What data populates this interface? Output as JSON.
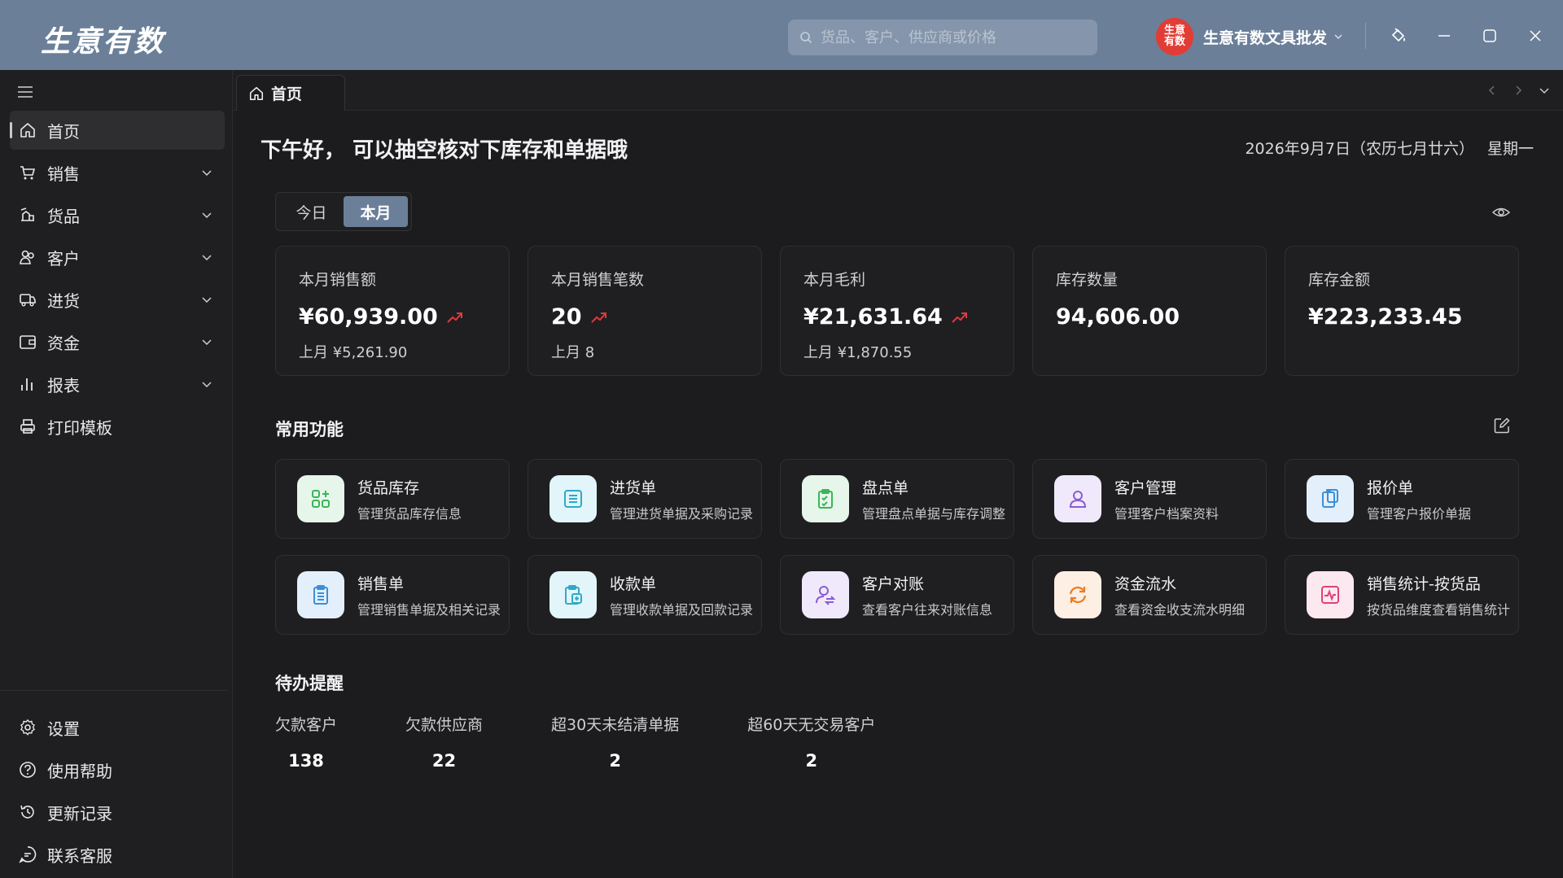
{
  "app": {
    "brand": "生意有数",
    "search_placeholder": "货品、客户、供应商或价格",
    "account_badge": "生意有数",
    "account_name": "生意有数文具批发"
  },
  "sidebar": {
    "items": [
      {
        "label": "首页",
        "icon": "home-icon",
        "active": true
      },
      {
        "label": "销售",
        "icon": "cart-icon"
      },
      {
        "label": "货品",
        "icon": "goods-icon"
      },
      {
        "label": "客户",
        "icon": "customer-icon"
      },
      {
        "label": "进货",
        "icon": "truck-icon"
      },
      {
        "label": "资金",
        "icon": "wallet-icon"
      },
      {
        "label": "报表",
        "icon": "chart-icon"
      },
      {
        "label": "打印模板",
        "icon": "printer-icon"
      }
    ],
    "bottom": [
      {
        "label": "设置",
        "icon": "gear-icon"
      },
      {
        "label": "使用帮助",
        "icon": "help-icon"
      },
      {
        "label": "更新记录",
        "icon": "history-icon"
      },
      {
        "label": "联系客服",
        "icon": "chat-icon"
      }
    ]
  },
  "tabs": [
    {
      "label": "首页"
    }
  ],
  "main": {
    "greeting": "下午好，  可以抽空核对下库存和单据哦",
    "date": "2026年9月7日（农历七月廿六）",
    "weekday": "星期一",
    "segments": [
      "今日",
      "本月"
    ],
    "stats": [
      {
        "label": "本月销售额",
        "value": "¥60,939.00",
        "prev": "上月 ¥5,261.90",
        "trend": "up"
      },
      {
        "label": "本月销售笔数",
        "value": "20",
        "prev": "上月 8",
        "trend": "up"
      },
      {
        "label": "本月毛利",
        "value": "¥21,631.64",
        "prev": "上月 ¥1,870.55",
        "trend": "up"
      },
      {
        "label": "库存数量",
        "value": "94,606.00"
      },
      {
        "label": "库存金额",
        "value": "¥223,233.45"
      }
    ],
    "functions_title": "常用功能",
    "functions": [
      {
        "title": "货品库存",
        "desc": "管理货品库存信息",
        "color": "#3bb55a",
        "bg": "#e6f6ea"
      },
      {
        "title": "进货单",
        "desc": "管理进货单据及采购记录",
        "color": "#2fa9c7",
        "bg": "#e2f5fa"
      },
      {
        "title": "盘点单",
        "desc": "管理盘点单据与库存调整",
        "color": "#3bb55a",
        "bg": "#e6f6ea"
      },
      {
        "title": "客户管理",
        "desc": "管理客户档案资料",
        "color": "#8a5bd6",
        "bg": "#f0e9fb"
      },
      {
        "title": "报价单",
        "desc": "管理客户报价单据",
        "color": "#3a8fd9",
        "bg": "#e3f0fb"
      },
      {
        "title": "销售单",
        "desc": "管理销售单据及相关记录",
        "color": "#3a8fd9",
        "bg": "#e3f0fb"
      },
      {
        "title": "收款单",
        "desc": "管理收款单据及回款记录",
        "color": "#2fa9c7",
        "bg": "#e2f5fa"
      },
      {
        "title": "客户对账",
        "desc": "查看客户往来对账信息",
        "color": "#8a5bd6",
        "bg": "#f0e9fb"
      },
      {
        "title": "资金流水",
        "desc": "查看资金收支流水明细",
        "color": "#f07b22",
        "bg": "#fdefe3"
      },
      {
        "title": "销售统计-按货品",
        "desc": "按货品维度查看销售统计",
        "color": "#e0407a",
        "bg": "#fce8ef"
      }
    ],
    "todo_title": "待办提醒",
    "todo": [
      {
        "label": "欠款客户",
        "value": "138"
      },
      {
        "label": "欠款供应商",
        "value": "22"
      },
      {
        "label": "超30天未结清单据",
        "value": "2"
      },
      {
        "label": "超60天无交易客户",
        "value": "2"
      }
    ]
  },
  "colors": {
    "titlebar": "#6b7f99",
    "trend_up": "#e0393e",
    "accent": "#6b7f99"
  }
}
